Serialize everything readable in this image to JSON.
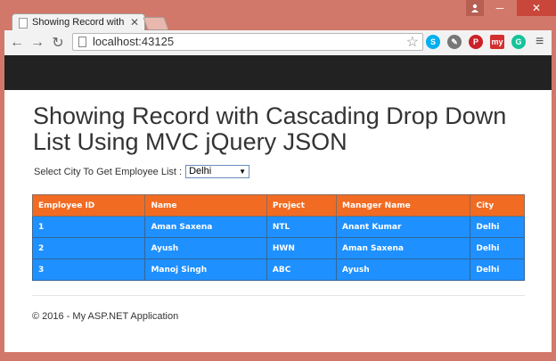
{
  "browser": {
    "tab_title": "Showing Record with Cas",
    "tab_close": "✕",
    "url": "localhost:43125",
    "user_icon": "user-icon",
    "window_controls": {
      "minimize": "─",
      "maximize": "☐",
      "close": "✕"
    },
    "nav": {
      "back": "←",
      "forward": "→",
      "reload": "↻"
    },
    "extensions": [
      {
        "name": "skype-icon",
        "label": "S",
        "color": "#00aff0"
      },
      {
        "name": "eyedropper-icon",
        "label": "✎",
        "color": "#777777"
      },
      {
        "name": "pinterest-icon",
        "label": "P",
        "color": "#cb2027"
      },
      {
        "name": "my-icon",
        "label": "my",
        "color": "#d32f2f"
      },
      {
        "name": "grammarly-icon",
        "label": "G",
        "color": "#15c39a"
      }
    ],
    "menu_icon": "≡"
  },
  "page": {
    "title": "Showing Record with Cascading Drop Down List Using MVC jQuery JSON",
    "filter_label": "Select City To Get Employee List :",
    "selected_city": "Delhi",
    "table": {
      "headers": [
        "Employee ID",
        "Name",
        "Project",
        "Manager Name",
        "City"
      ],
      "rows": [
        [
          "1",
          "Aman Saxena",
          "NTL",
          "Anant Kumar",
          "Delhi"
        ],
        [
          "2",
          "Ayush",
          "HWN",
          "Aman Saxena",
          "Delhi"
        ],
        [
          "3",
          "Manoj Singh",
          "ABC",
          "Ayush",
          "Delhi"
        ]
      ]
    },
    "footer": "© 2016 - My ASP.NET Application"
  }
}
